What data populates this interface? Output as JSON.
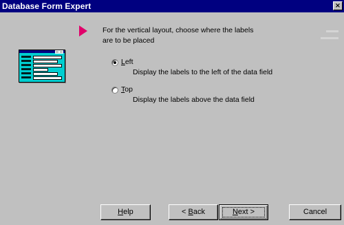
{
  "window": {
    "title": "Database Form Expert",
    "close_glyph": "×"
  },
  "instruction": {
    "line1": "For the vertical layout, choose where the labels",
    "line2": "are to be placed"
  },
  "illustration": {
    "icon": "form-layout-preview-icon"
  },
  "options": [
    {
      "label_underlined": "L",
      "label_rest": "eft",
      "description": "Display the labels to the left of the data field",
      "selected": true
    },
    {
      "label_underlined": "T",
      "label_rest": "op",
      "description": "Display the labels above the data field",
      "selected": false
    }
  ],
  "buttons": {
    "help": {
      "underlined": "H",
      "rest": "elp"
    },
    "back": {
      "prefix": "< ",
      "underlined": "B",
      "rest": "ack"
    },
    "next": {
      "underlined": "N",
      "rest": "ext >"
    },
    "cancel": "Cancel"
  },
  "colors": {
    "titlebar": "#000080",
    "pointer": "#e0006a",
    "dialog": "#c0c0c0",
    "preview": "#00ced0"
  }
}
